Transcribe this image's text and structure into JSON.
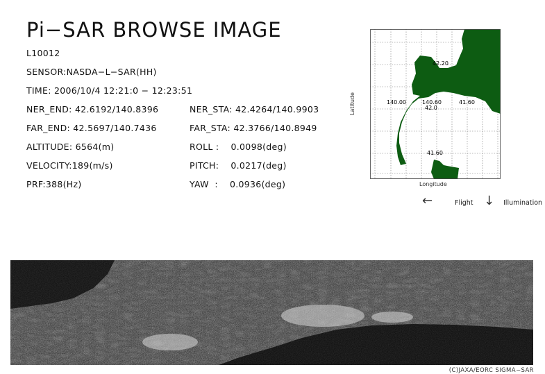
{
  "header": {
    "title": "Pi−SAR BROWSE IMAGE",
    "scene_id": "L10012",
    "sensor": "SENSOR:NASDA−L−SAR(HH)",
    "time": "TIME: 2006/10/4  12:21:0 − 12:23:51"
  },
  "params_left": [
    "NER_END: 42.6192/140.8396",
    "FAR_END: 42.5697/140.7436",
    "ALTITUDE: 6564(m)",
    "VELOCITY:189(m/s)",
    "PRF:388(Hz)"
  ],
  "params_right": [
    "NER_STA: 42.4264/140.9903",
    "FAR_STA: 42.3766/140.8949",
    "ROLL :    0.0098(deg)",
    "PITCH:    0.0217(deg)",
    "YAW  :    0.0936(deg)"
  ],
  "map": {
    "xlabel": "Longitude",
    "ylabel": "Latitude",
    "labels": [
      "42.20",
      "140.00",
      "140.60",
      "41.60",
      "42.0",
      "41.60"
    ],
    "land_color": "#0d5c12",
    "grid_color": "#666666"
  },
  "legend": {
    "flight_label": "Flight",
    "illumination_label": "Illumination",
    "flight_arrow": "←",
    "illumination_arrow": "↓"
  },
  "footer": {
    "copyright": "(C)JAXA/EORC SIGMA−SAR"
  }
}
